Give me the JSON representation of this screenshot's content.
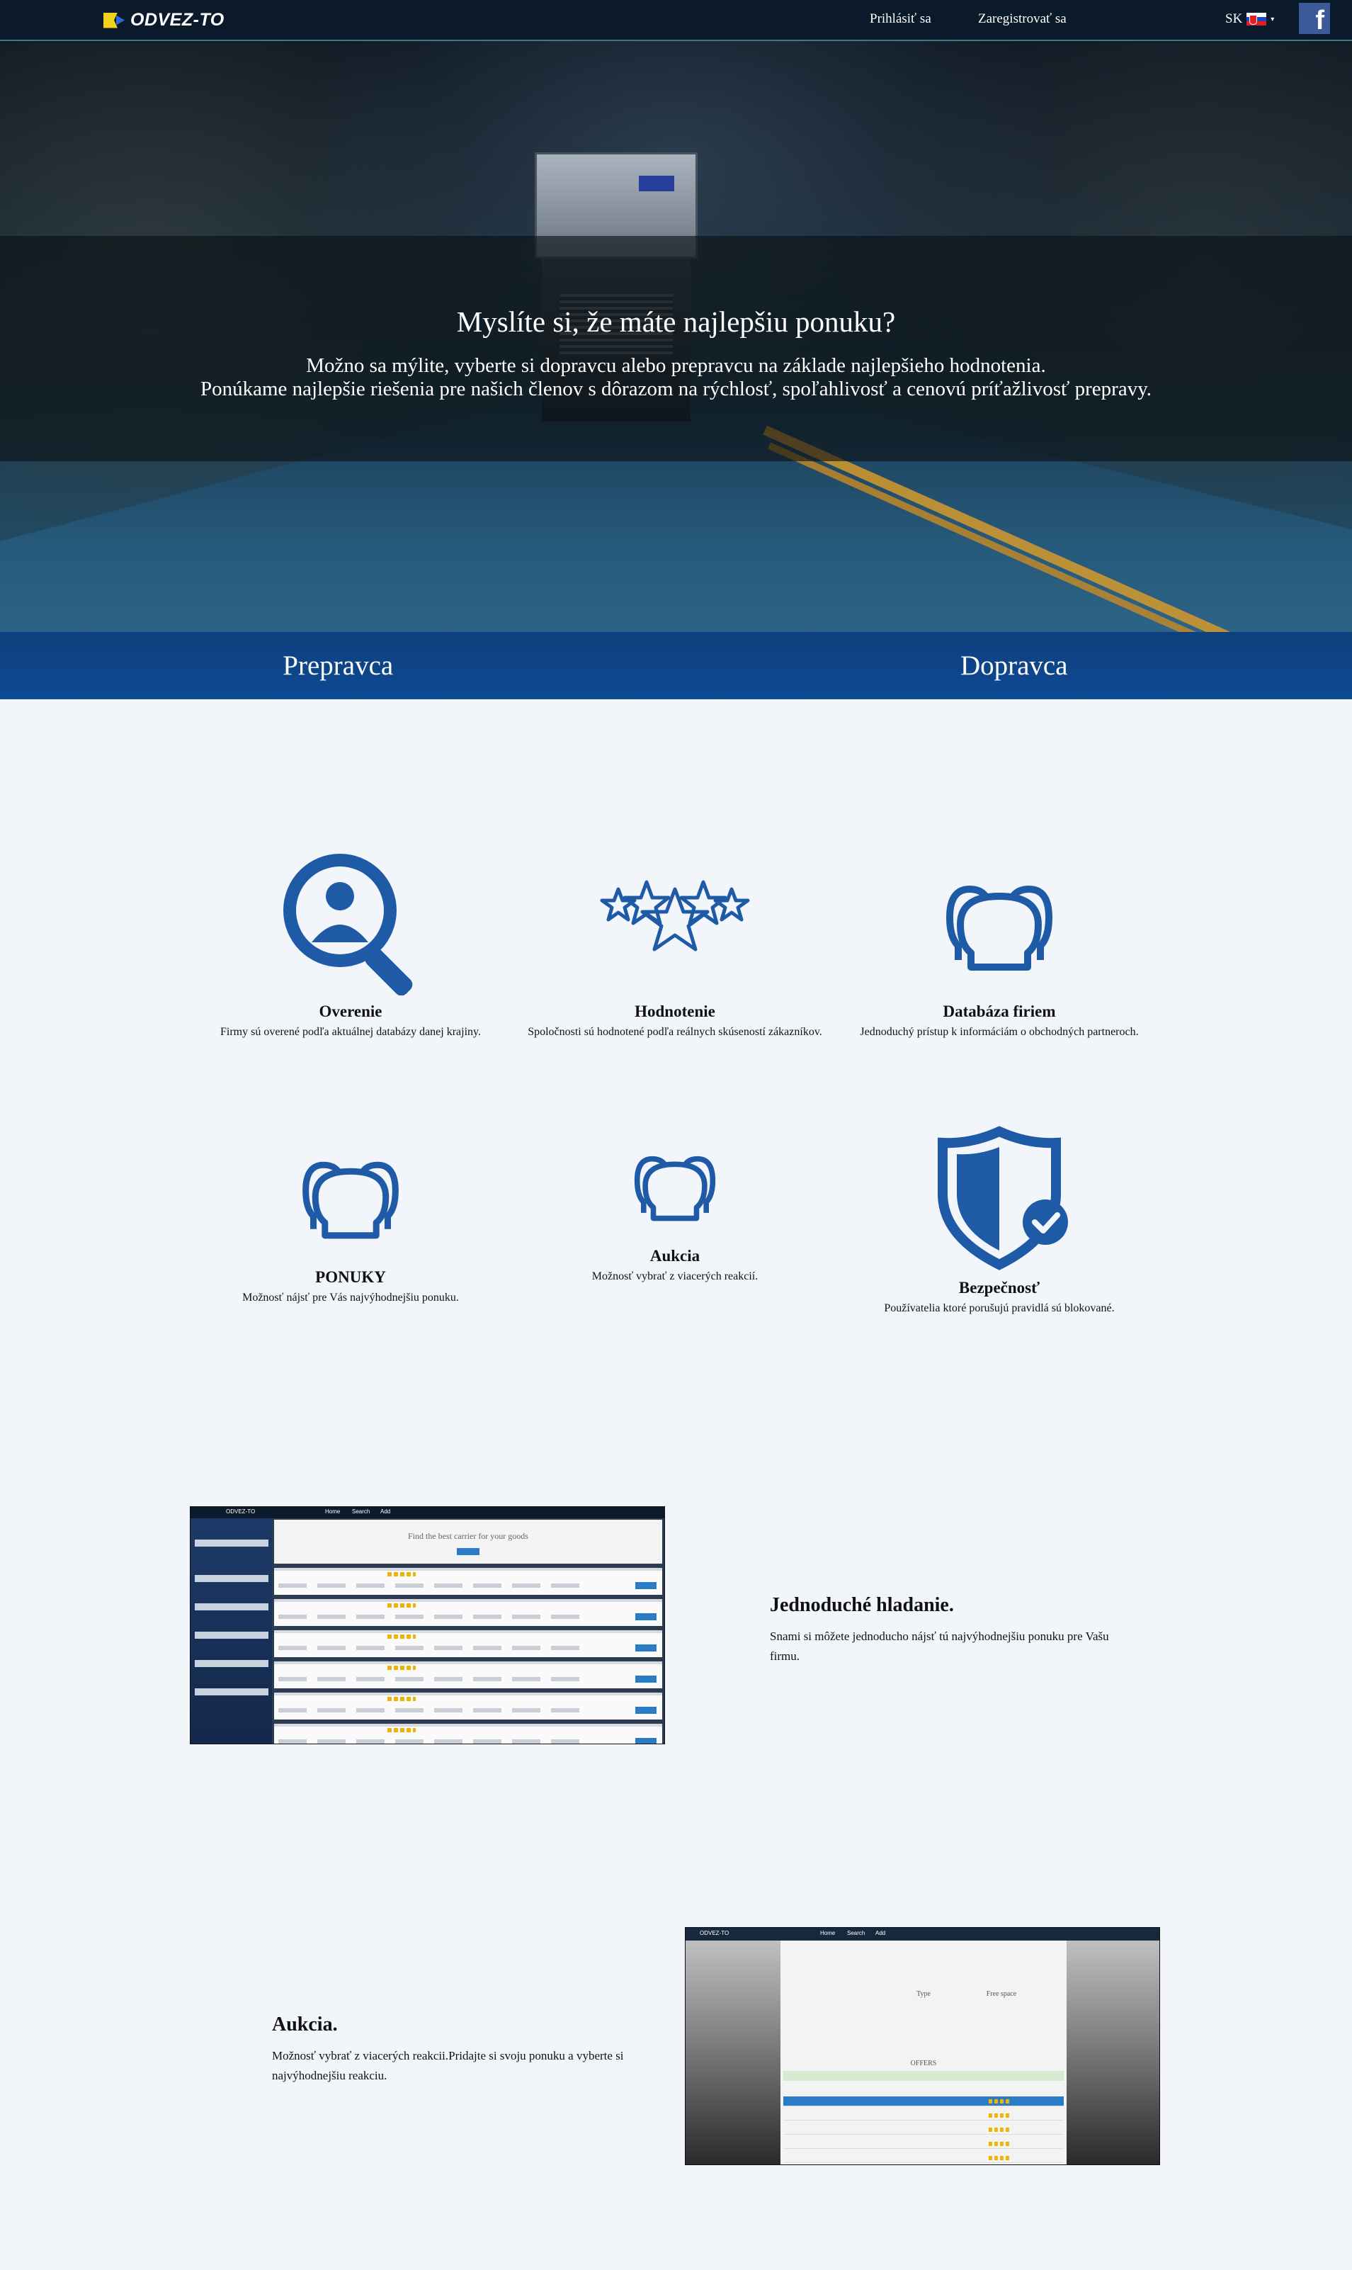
{
  "nav": {
    "logo_text": "ODVEZ-TO",
    "login": "Prihlásiť sa",
    "register": "Zaregistrovať sa",
    "language": "SK",
    "facebook_glyph": "f"
  },
  "hero": {
    "title": "Myslíte si, že máte najlepšiu ponuku?",
    "line1": "Možno sa mýlite, vyberte si dopravcu alebo prepravcu na základe najlepšieho hodnotenia.",
    "line2": "Ponúkame najlepšie riešenia pre našich členov s dôrazom na rýchlosť, spoľahlivosť a cenovú príťažlivosť prepravy."
  },
  "tabs": [
    "Prepravca",
    "Dopravca"
  ],
  "features": [
    {
      "icon": "search-person-icon",
      "title": "Overenie",
      "text": "Firmy sú overené podľa aktuálnej databázy danej krajiny."
    },
    {
      "icon": "stars-icon",
      "title": "Hodnotenie",
      "text": "Spoločnosti sú hodnotené podľa reálnych skúseností zákazníkov."
    },
    {
      "icon": "users-group-icon",
      "title": "Databáza firiem",
      "text": "Jednoduchý prístup k informáciám o obchodných partneroch."
    },
    {
      "icon": "users-group-icon",
      "title": "PONUKY",
      "text": "Možnosť nájsť pre Vás najvýhodnejšiu ponuku."
    },
    {
      "icon": "users-group-icon",
      "title": "Aukcia",
      "text": "Možnosť vybrať z viacerých reakcií."
    },
    {
      "icon": "shield-check-icon",
      "title": "Bezpečnosť",
      "text": "Používatelia ktoré porušujú pravidlá sú blokované."
    }
  ],
  "showcase": {
    "search": {
      "title": "Jednoduché hladanie.",
      "text": "Snami si môžete jednoducho nájsť tú najvýhodnejšiu ponuku pre Vašu firmu.",
      "shot_heading": "Find the best carrier for your goods",
      "shot_nav": [
        "Home",
        "Search",
        "Add"
      ]
    },
    "auction": {
      "title": "Aukcia.",
      "text": "Možnosť vybrať z viacerých reakcii.Pridajte si svoju ponuku a vyberte si najvýhodnejšiu reakciu.",
      "shot_labels": [
        "Type",
        "Free space",
        "OFFERS"
      ]
    }
  },
  "colors": {
    "accent_blue": "#1f5aa6",
    "tab_blue": "#0d4a93",
    "nav_bg": "#0b1a2b"
  }
}
